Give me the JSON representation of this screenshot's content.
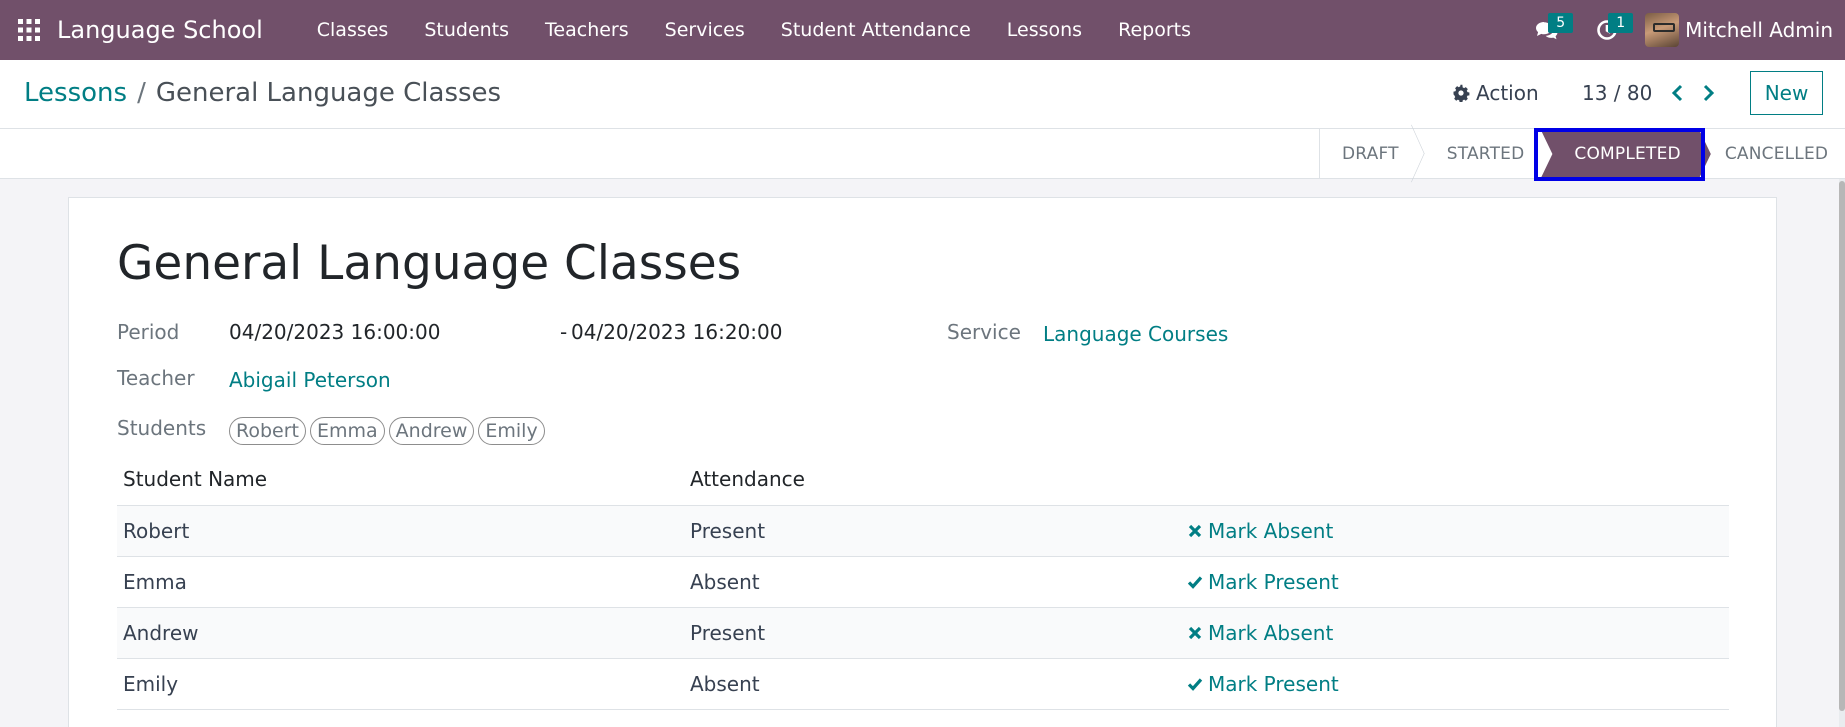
{
  "app": {
    "name": "Language School",
    "menu": [
      "Classes",
      "Students",
      "Teachers",
      "Services",
      "Student Attendance",
      "Lessons",
      "Reports"
    ],
    "messages_count": "5",
    "activities_count": "1",
    "user_name": "Mitchell Admin"
  },
  "control": {
    "breadcrumb_parent": "Lessons",
    "breadcrumb_separator": "/",
    "breadcrumb_current": "General Language Classes",
    "action_label": "Action",
    "pager": "13 / 80",
    "new_label": "New"
  },
  "statusbar": {
    "stages": [
      "DRAFT",
      "STARTED",
      "COMPLETED",
      "CANCELLED"
    ],
    "active_stage": "COMPLETED"
  },
  "form": {
    "title": "General Language Classes",
    "period_label": "Period",
    "period_start": "04/20/2023 16:00:00",
    "period_dash": "-",
    "period_end": "04/20/2023 16:20:00",
    "service_label": "Service",
    "service_value": "Language Courses",
    "teacher_label": "Teacher",
    "teacher_value": "Abigail Peterson",
    "students_label": "Students",
    "students": [
      "Robert",
      "Emma",
      "Andrew",
      "Emily"
    ]
  },
  "attendance_table": {
    "columns": [
      "Student Name",
      "Attendance"
    ],
    "rows": [
      {
        "name": "Robert",
        "attendance": "Present",
        "action": "Mark Absent",
        "action_icon": "times-icon"
      },
      {
        "name": "Emma",
        "attendance": "Absent",
        "action": "Mark Present",
        "action_icon": "check-icon"
      },
      {
        "name": "Andrew",
        "attendance": "Present",
        "action": "Mark Absent",
        "action_icon": "times-icon"
      },
      {
        "name": "Emily",
        "attendance": "Absent",
        "action": "Mark Present",
        "action_icon": "check-icon"
      }
    ]
  },
  "colors": {
    "navbar": "#71506a",
    "accent": "#017e84",
    "highlight_frame": "#0000e6"
  }
}
